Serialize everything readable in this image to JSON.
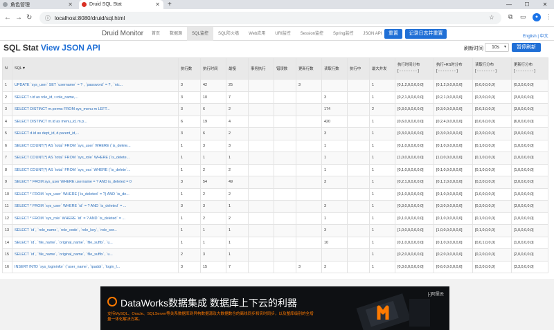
{
  "browser": {
    "tabs": [
      {
        "title": "角色管理",
        "active": false
      },
      {
        "title": "Druid SQL Stat",
        "active": true
      }
    ],
    "url": "localhost:8080/druid/sql.html"
  },
  "header": {
    "brand": "Druid Monitor",
    "nav": [
      "首页",
      "数据源",
      "SQL监控",
      "SQL防火墙",
      "Web应用",
      "URI监控",
      "Session监控",
      "Spring监控",
      "JSON API"
    ],
    "active_nav": "SQL监控",
    "reset_label": "重置",
    "log_reset_label": "记录日志并重置",
    "lang_en": "English",
    "lang_sep": " | ",
    "lang_zh": "中文"
  },
  "page": {
    "title": "SQL Stat",
    "json_link": "View JSON API",
    "refresh_label": "刷新时间",
    "refresh_value": "10s",
    "stop_refresh_label": "暂停刷新"
  },
  "table": {
    "headers": [
      "N",
      "SQL▼",
      "执行数",
      "执行时间",
      "最慢",
      "事务执行",
      "错误数",
      "更新行数",
      "读取行数",
      "执行中",
      "最大并发",
      "执行时间分布",
      "执行+RS时分布",
      "读取行分布",
      "更新行分布"
    ],
    "dist_sub": "[ - - - - - - - - ]",
    "rows": [
      [
        "1",
        "UPDATE `sys_user` SET `username` = ? , `password` = ? , `nic...",
        "3",
        "42",
        "25",
        "",
        "",
        "3",
        "",
        "",
        "1",
        "[0,1,2,0,0,0,0,0]",
        "[0,1,2,0,0,0,0,0]",
        "[0,0,0,0,0,0]",
        "[0,3,0,0,0,0]"
      ],
      [
        "2",
        "SELECT r.id as role_id, r.role_name,...",
        "3",
        "10",
        "7",
        "",
        "",
        "",
        "3",
        "",
        "1",
        "[0,2,1,0,0,0,0,0]",
        "[0,2,1,0,0,0,0,0]",
        "[0,3,0,0,0,0]",
        "[3,0,0,0,0,0]"
      ],
      [
        "3",
        "SELECT DISTINCT m.perms FROM sys_menu m LEFT...",
        "3",
        "6",
        "2",
        "",
        "",
        "",
        "174",
        "",
        "2",
        "[0,3,0,0,0,0,0,0]",
        "[0,3,0,0,0,0,0,0]",
        "[0,0,3,0,0,0]",
        "[3,0,0,0,0,0]"
      ],
      [
        "4",
        "SELECT DISTINCT m.id as menu_id, m.p...",
        "6",
        "19",
        "4",
        "",
        "",
        "",
        "420",
        "",
        "1",
        "[0,6,0,0,0,0,0,0]",
        "[0,2,4,0,0,0,0,0]",
        "[0,0,6,0,0,0]",
        "[6,0,0,0,0,0]"
      ],
      [
        "5",
        "SELECT d.id as dept_id, d.parent_id,...",
        "3",
        "6",
        "2",
        "",
        "",
        "",
        "3",
        "",
        "1",
        "[0,3,0,0,0,0,0,0]",
        "[0,3,0,0,0,0,0,0]",
        "[0,3,0,0,0,0]",
        "[3,0,0,0,0,0]"
      ],
      [
        "6",
        "SELECT COUNT(*) AS `total` FROM `sys_user` WHERE (`is_delete...",
        "1",
        "3",
        "3",
        "",
        "",
        "",
        "1",
        "",
        "1",
        "[0,1,0,0,0,0,0,0]",
        "[0,1,0,0,0,0,0,0]",
        "[0,1,0,0,0,0]",
        "[1,0,0,0,0,0]"
      ],
      [
        "7",
        "SELECT COUNT(*) AS `total` FROM `sys_role` WHERE (`is_delete...",
        "1",
        "1",
        "1",
        "",
        "",
        "",
        "1",
        "",
        "1",
        "[1,0,0,0,0,0,0,0]",
        "[1,0,0,0,0,0,0,0]",
        "[0,1,0,0,0,0]",
        "[1,0,0,0,0,0]"
      ],
      [
        "8",
        "SELECT COUNT(*) AS `total` FROM `sys_oss` WHERE (`is_delete`...",
        "1",
        "2",
        "2",
        "",
        "",
        "",
        "1",
        "",
        "1",
        "[0,1,0,0,0,0,0,0]",
        "[0,1,0,0,0,0,0,0]",
        "[0,1,0,0,0,0]",
        "[1,0,0,0,0,0]"
      ],
      [
        "9",
        "SELECT * FROM sys_user WHERE username = ? AND is_deleted = 0",
        "3",
        "54",
        "49",
        "",
        "",
        "",
        "3",
        "",
        "1",
        "[0,2,1,0,0,0,0,0]",
        "[0,1,2,0,0,0,0,0]",
        "[0,3,0,0,0,0]",
        "[3,0,0,0,0,0]"
      ],
      [
        "10",
        "SELECT * FROM `sys_user` WHERE (`is_deleted` = ?) AND `is_de...",
        "1",
        "2",
        "2",
        "",
        "",
        "",
        "",
        "",
        "1",
        "[0,1,0,0,0,0,0,0]",
        "[0,1,0,0,0,0,0,0]",
        "[1,0,0,0,0,0]",
        "[1,0,0,0,0,0]"
      ],
      [
        "11",
        "SELECT * FROM `sys_user` WHERE `id` = ? AND `is_deleted` = ...",
        "3",
        "3",
        "1",
        "",
        "",
        "",
        "3",
        "",
        "1",
        "[0,3,0,0,0,0,0,0]",
        "[0,3,0,0,0,0,0,0]",
        "[0,3,0,0,0,0]",
        "[3,0,0,0,0,0]"
      ],
      [
        "12",
        "SELECT * FROM `sys_role` WHERE `id` = ? AND `is_deleted` = ...",
        "1",
        "2",
        "2",
        "",
        "",
        "",
        "1",
        "",
        "1",
        "[0,1,0,0,0,0,0,0]",
        "[0,1,0,0,0,0,0,0]",
        "[0,1,0,0,0,0]",
        "[1,0,0,0,0,0]"
      ],
      [
        "13",
        "SELECT `id`, `role_name`, `role_code`, `role_key`, `role_sor...",
        "1",
        "1",
        "1",
        "",
        "",
        "",
        "3",
        "",
        "1",
        "[1,0,0,0,0,0,0,0]",
        "[1,0,0,0,0,0,0,0]",
        "[0,1,0,0,0,0]",
        "[1,0,0,0,0,0]"
      ],
      [
        "14",
        "SELECT `id`, `file_name`, `original_name`, `file_suffix`, `u...",
        "1",
        "1",
        "1",
        "",
        "",
        "",
        "10",
        "",
        "1",
        "[0,1,0,0,0,0,0,0]",
        "[0,1,0,0,0,0,0,0]",
        "[0,0,1,0,0,0]",
        "[1,0,0,0,0,0]"
      ],
      [
        "15",
        "SELECT `id`, `file_name`, `original_name`, `file_suffix`, `u...",
        "2",
        "3",
        "1",
        "",
        "",
        "",
        "",
        "",
        "1",
        "[0,2,0,0,0,0,0,0]",
        "[0,2,0,0,0,0,0,0]",
        "[0,2,0,0,0,0]",
        "[2,0,0,0,0,0]"
      ],
      [
        "16",
        "INSERT INTO `sys_logininfor` (`user_name`, `ipaddr`, `login_l...",
        "3",
        "15",
        "7",
        "",
        "",
        "3",
        "3",
        "",
        "1",
        "[0,3,0,0,0,0,0,0]",
        "[0,6,0,0,0,0,0,0]",
        "[0,3,0,0,0,0]",
        "[3,3,0,0,0,0]"
      ]
    ]
  },
  "banner": {
    "title": "DataWorks数据集成 数据库上下云的利器",
    "subtitle": "支持MySQL、Oracle、SQLServer等关系数据库到异构数据源及大数据数仓的离线同步和实时同步，以及整库级别的全增量一体化解决方案。",
    "logo": "[-]阿里云",
    "colors": {
      "accent": "#ff7a00",
      "bg": "#0e1013"
    }
  }
}
